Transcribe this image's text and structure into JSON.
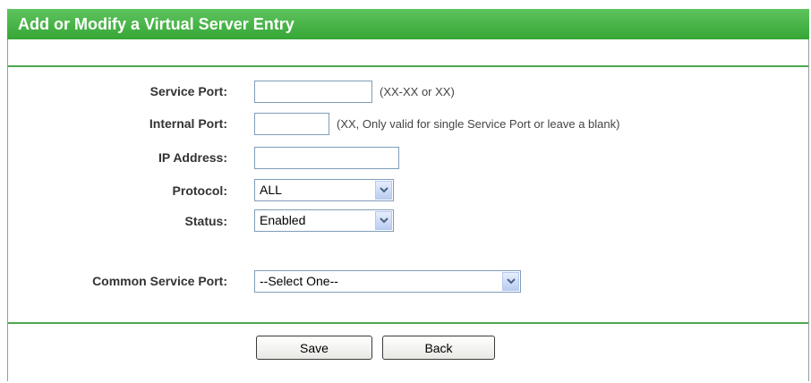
{
  "header": {
    "title": "Add or Modify a Virtual Server Entry"
  },
  "form": {
    "service_port": {
      "label": "Service Port:",
      "value": "",
      "hint": "(XX-XX or XX)"
    },
    "internal_port": {
      "label": "Internal Port:",
      "value": "",
      "hint": "(XX, Only valid for single Service Port or leave a blank)"
    },
    "ip_address": {
      "label": "IP Address:",
      "value": ""
    },
    "protocol": {
      "label": "Protocol:",
      "selected": "ALL"
    },
    "status": {
      "label": "Status:",
      "selected": "Enabled"
    },
    "common_service_port": {
      "label": "Common Service Port:",
      "selected": "--Select One--"
    }
  },
  "buttons": {
    "save": "Save",
    "back": "Back"
  },
  "colors": {
    "header_bg": "#35a635",
    "divider": "#4ea64e",
    "input_border": "#7f9db9"
  }
}
